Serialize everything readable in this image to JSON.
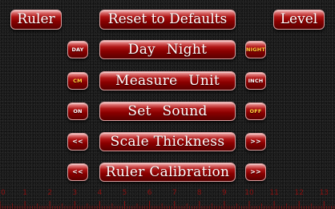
{
  "top_bar": {
    "ruler_label": "Ruler",
    "reset_label": "Reset to Defaults",
    "level_label": "Level"
  },
  "rows": {
    "day_night": {
      "left": "DAY",
      "label": "Day  Night",
      "right": "NIGHT",
      "active": "right"
    },
    "measure_unit": {
      "left": "CM",
      "label": "Measure  Unit",
      "right": "INCH",
      "active": "left"
    },
    "set_sound": {
      "left": "ON",
      "label": "Set  Sound",
      "right": "OFF",
      "active": "right"
    },
    "scale_thickness": {
      "left": "<<",
      "label": "Scale  Thickness",
      "right": ">>"
    },
    "ruler_calibration": {
      "left": "<<",
      "label": "Ruler Calibration",
      "right": ">>"
    }
  },
  "ruler": {
    "unit": "cm",
    "labels": [
      "0",
      "1",
      "2",
      "3",
      "4",
      "5",
      "6",
      "7",
      "8",
      "9",
      "10",
      "11",
      "12",
      "13"
    ],
    "colors": {
      "ticks": "#8a0f0f",
      "labels": "#8a0f0f"
    }
  },
  "colors": {
    "button_base": "#8a0000",
    "button_highlight": "#f3b8b8",
    "text": "#ffffff",
    "active_text": "#ffd23a",
    "background": "#1a1a1a"
  }
}
